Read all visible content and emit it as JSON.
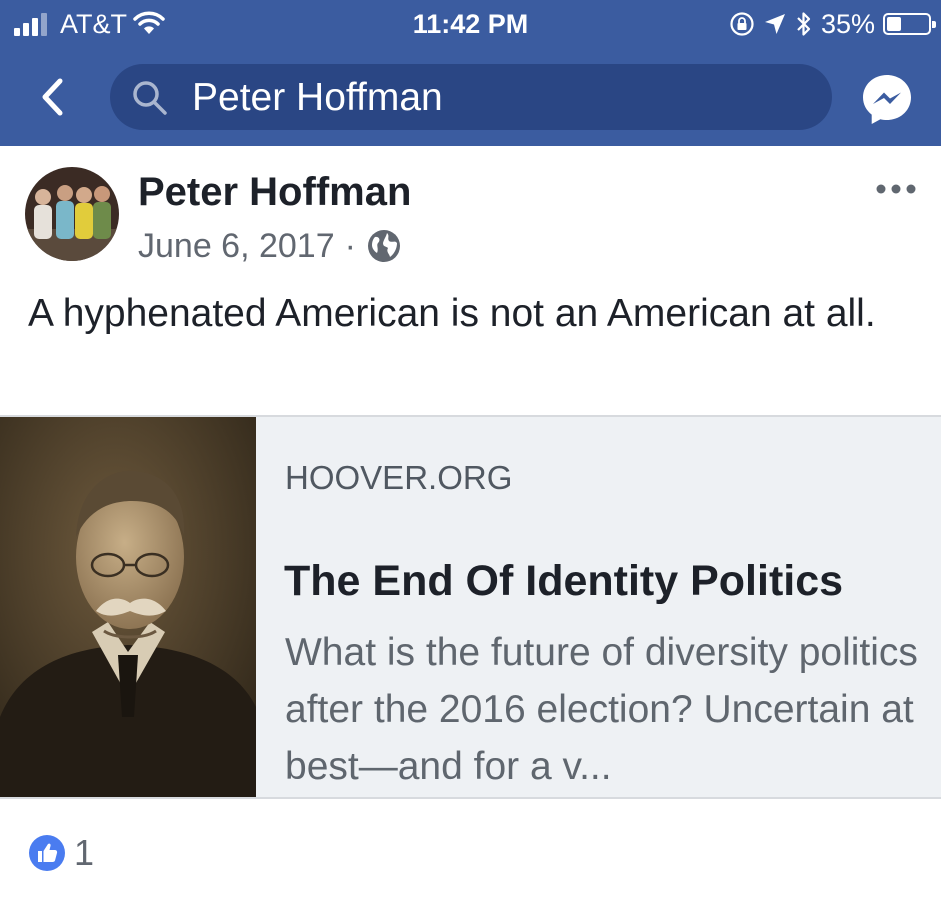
{
  "status_bar": {
    "carrier": "AT&T",
    "time": "11:42 PM",
    "battery_percent_label": "35%",
    "battery_level": 0.35
  },
  "nav": {
    "search_value": "Peter Hoffman",
    "icons": [
      "back-chevron-icon",
      "search-icon",
      "messenger-icon"
    ]
  },
  "post": {
    "author": "Peter Hoffman",
    "date": "June 6, 2017",
    "separator": "·",
    "audience_icon": "globe-icon",
    "text": "A hyphenated American is not an American at all.",
    "link": {
      "domain": "HOOVER.ORG",
      "title": "The End Of Identity Politics",
      "description": "What is the future of diversity politics after the 2016 election? Uncertain at best—and for a v..."
    },
    "reactions": {
      "icon": "like-icon",
      "count": "1"
    }
  },
  "colors": {
    "nav_blue": "#3b5ca0",
    "search_pill": "#2a4684",
    "link_card_bg": "#eef1f4",
    "like_blue": "#4a7cf0"
  }
}
